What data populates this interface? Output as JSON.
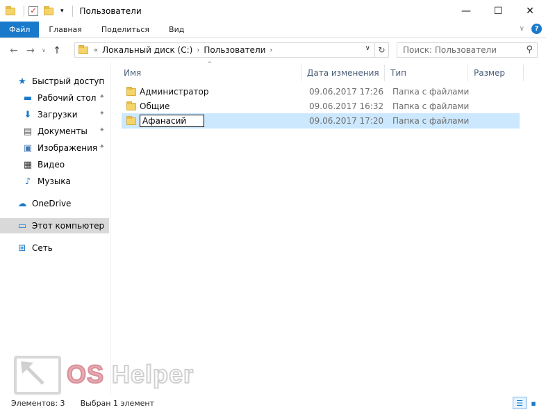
{
  "window": {
    "title": "Пользователи",
    "minimize_glyph": "—",
    "maximize_glyph": "☐",
    "close_glyph": "✕"
  },
  "quick_access_toolbar": {
    "dropdown_glyph": "▾"
  },
  "ribbon": {
    "tabs": [
      {
        "label": "Файл"
      },
      {
        "label": "Главная"
      },
      {
        "label": "Поделиться"
      },
      {
        "label": "Вид"
      }
    ],
    "collapse_glyph": "∨",
    "help_glyph": "?"
  },
  "navigation": {
    "back_glyph": "←",
    "forward_glyph": "→",
    "recent_glyph": "∨",
    "up_glyph": "↑",
    "address": {
      "overflow": "«",
      "crumbs": [
        "Локальный диск (C:)",
        "Пользователи"
      ],
      "separator": "›",
      "dropdown_glyph": "∨"
    },
    "refresh_glyph": "↻",
    "search": {
      "placeholder": "Поиск: Пользователи",
      "icon_glyph": "⚲"
    }
  },
  "sidebar": {
    "items": [
      {
        "label": "Быстрый доступ",
        "icon": "star-icon",
        "glyph": "★",
        "color": "#1979ca"
      },
      {
        "label": "Рабочий стол",
        "icon": "desktop-icon",
        "glyph": "▬",
        "color": "#1979ca",
        "pinned": true
      },
      {
        "label": "Загрузки",
        "icon": "download-icon",
        "glyph": "⬇",
        "color": "#1979ca",
        "pinned": true
      },
      {
        "label": "Документы",
        "icon": "documents-icon",
        "glyph": "▤",
        "color": "#555555",
        "pinned": true
      },
      {
        "label": "Изображения",
        "icon": "pictures-icon",
        "glyph": "▣",
        "color": "#4a7ab5",
        "pinned": true
      },
      {
        "label": "Видео",
        "icon": "video-icon",
        "glyph": "▦",
        "color": "#333333"
      },
      {
        "label": "Музыка",
        "icon": "music-icon",
        "glyph": "♪",
        "color": "#1979ca"
      },
      {
        "label": "OneDrive",
        "icon": "cloud-icon",
        "glyph": "☁",
        "color": "#1979ca"
      },
      {
        "label": "Этот компьютер",
        "icon": "computer-icon",
        "glyph": "▭",
        "color": "#1979ca",
        "selected": true
      },
      {
        "label": "Сеть",
        "icon": "network-icon",
        "glyph": "⊞",
        "color": "#1979ca"
      }
    ],
    "pin_glyph": "✦"
  },
  "columns": [
    {
      "label": "Имя"
    },
    {
      "label": "Дата изменения"
    },
    {
      "label": "Тип"
    },
    {
      "label": "Размер"
    }
  ],
  "sort_glyph": "^",
  "files": [
    {
      "name": "Администратор",
      "date": "09.06.2017 17:26",
      "type": "Папка с файлами"
    },
    {
      "name": "Общие",
      "date": "09.06.2017 16:32",
      "type": "Папка с файлами"
    },
    {
      "name": "Афанасий",
      "date": "09.06.2017 17:20",
      "type": "Папка с файлами",
      "selected": true,
      "editing": true
    }
  ],
  "watermark": {
    "text_a": "OS",
    "text_b": " Helper"
  },
  "status": {
    "items_count": "Элементов: 3",
    "selected": "Выбран 1 элемент",
    "details_view_glyph": "☰",
    "tiles_view_glyph": "▪"
  },
  "colors": {
    "accent": "#1979ca",
    "selection": "#cce8ff",
    "folder": "#f5d46a"
  }
}
